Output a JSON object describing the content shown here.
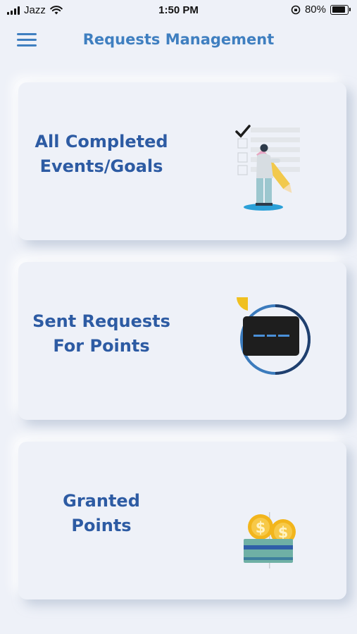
{
  "status_bar": {
    "carrier": "Jazz",
    "time": "1:50 PM",
    "battery": "80%",
    "battery_level": 0.8
  },
  "header": {
    "title": "Requests Management",
    "menu_icon": "hamburger-menu-icon"
  },
  "cards": [
    {
      "line1": "All Completed",
      "line2": "Events/Goals",
      "icon": "checklist-person-pencil-illustration"
    },
    {
      "line1": "Sent Requests",
      "line2": "For Points",
      "icon": "card-circle-illustration"
    },
    {
      "line1": "Granted",
      "line2": "Points",
      "icon": "coins-wallet-illustration"
    }
  ],
  "colors": {
    "background": "#eef1f8",
    "title": "#3f7fc0",
    "label": "#2d5ba3"
  }
}
